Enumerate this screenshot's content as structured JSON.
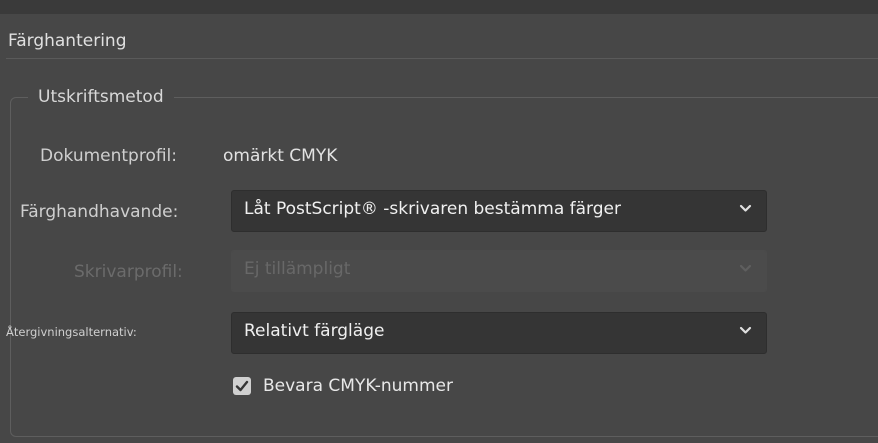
{
  "section": {
    "title": "Färghantering"
  },
  "print_method": {
    "legend": "Utskriftsmetod",
    "document_profile": {
      "label": "Dokumentprofil:",
      "value": "omärkt CMYK"
    },
    "color_handling": {
      "label": "Färghandhavande:",
      "selected": "Låt PostScript® -skrivaren bestämma färger",
      "chevron_icon": "chevron-down-icon"
    },
    "printer_profile": {
      "label": "Skrivarprofil:",
      "selected": "Ej tillämpligt",
      "disabled": true,
      "chevron_icon": "chevron-down-icon"
    },
    "rendering_intent": {
      "label": "Återgivningsalternativ:",
      "selected": "Relativt färgläge",
      "chevron_icon": "chevron-down-icon"
    },
    "preserve_cmyk": {
      "label": "Bevara CMYK-nummer",
      "checked": true,
      "icon": "checkmark-icon"
    }
  },
  "colors": {
    "panel_bg": "#474747",
    "dropdown_bg": "#353535",
    "text": "#cfcfcf",
    "disabled_text": "#6b6b6b"
  }
}
